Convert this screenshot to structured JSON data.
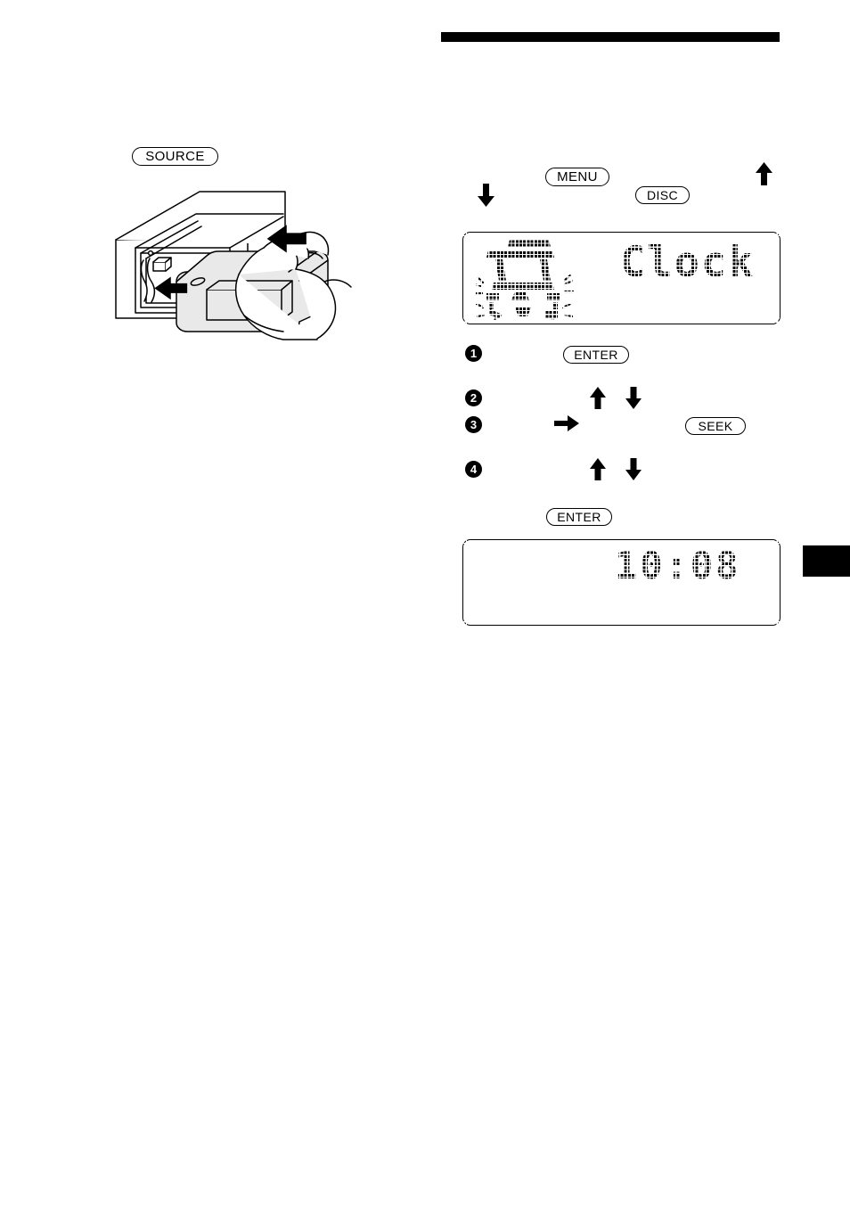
{
  "document": {
    "type": "car-stereo-manual-page",
    "header_rule": true,
    "edge_tab": true
  },
  "left_section": {
    "buttons": [
      {
        "name": "source",
        "label": "SOURCE"
      }
    ],
    "illustration": {
      "name": "front-panel-attachment-diagram",
      "description": "Hand sliding detachable front panel into car stereo chassis"
    }
  },
  "right_section": {
    "buttons": [
      {
        "name": "menu",
        "label": "MENU"
      },
      {
        "name": "disc",
        "label": "DISC"
      },
      {
        "name": "enter-step1",
        "label": "ENTER"
      },
      {
        "name": "seek",
        "label": "SEEK"
      },
      {
        "name": "enter-final",
        "label": "ENTER"
      }
    ],
    "arrows": [
      {
        "name": "arrow-down-top",
        "direction": "down"
      },
      {
        "name": "arrow-up-right",
        "direction": "up"
      },
      {
        "name": "arrow-up-step2",
        "direction": "up"
      },
      {
        "name": "arrow-down-step2",
        "direction": "down"
      },
      {
        "name": "arrow-right-step3",
        "direction": "right"
      },
      {
        "name": "arrow-up-step4",
        "direction": "up"
      },
      {
        "name": "arrow-down-step4",
        "direction": "down"
      }
    ],
    "steps": [
      {
        "number": "1"
      },
      {
        "number": "2"
      },
      {
        "number": "3"
      },
      {
        "number": "4"
      }
    ],
    "displays": [
      {
        "name": "menu-display",
        "text": "Clock",
        "icon": "blinking-menu-segment-icon",
        "blinking": true
      },
      {
        "name": "clock-display",
        "text": "10:08"
      }
    ]
  },
  "colors": {
    "ink": "#000000",
    "paper": "#ffffff",
    "panel_fill": "#e9e9e9"
  }
}
